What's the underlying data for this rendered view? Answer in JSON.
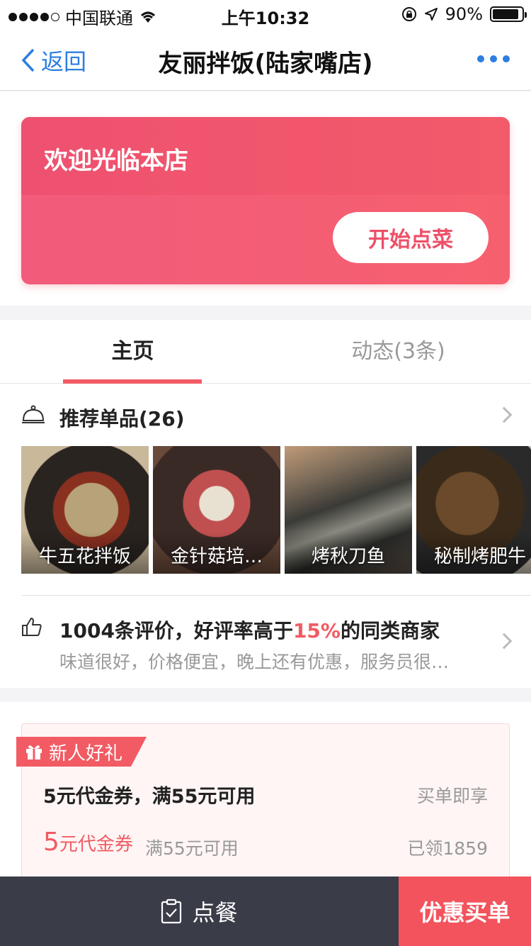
{
  "status_bar": {
    "carrier": "中国联通",
    "time": "上午10:32",
    "battery": "90%"
  },
  "nav": {
    "back_label": "返回",
    "title": "友丽拌饭(陆家嘴店)"
  },
  "welcome": {
    "title": "欢迎光临本店",
    "start_button": "开始点菜"
  },
  "tabs": [
    {
      "label": "主页",
      "active": true
    },
    {
      "label": "动态(3条)",
      "active": false
    }
  ],
  "recommended": {
    "title": "推荐单品(26)",
    "dishes": [
      {
        "name": "牛五花拌饭"
      },
      {
        "name": "金针菇培…"
      },
      {
        "name": "烤秋刀鱼"
      },
      {
        "name": "秘制烤肥牛"
      }
    ]
  },
  "reviews": {
    "title_prefix": "1004条评价，好评率高于",
    "title_highlight": "15%",
    "title_suffix": "的同类商家",
    "snippet": "味道很好，价格便宜，晚上还有优惠，服务员很…"
  },
  "coupon": {
    "badge": "新人好礼",
    "main_text": "5元代金券，满55元可用",
    "tag": "买单即享",
    "amount_number": "5",
    "amount_unit": "元代金券",
    "condition": "满55元可用",
    "claimed": "已领1859"
  },
  "bottom_bar": {
    "order_label": "点餐",
    "pay_label": "优惠买单"
  },
  "colors": {
    "accent": "#f25b63",
    "link_blue": "#2e7ee0",
    "bottom_dark": "#3a3c48"
  }
}
